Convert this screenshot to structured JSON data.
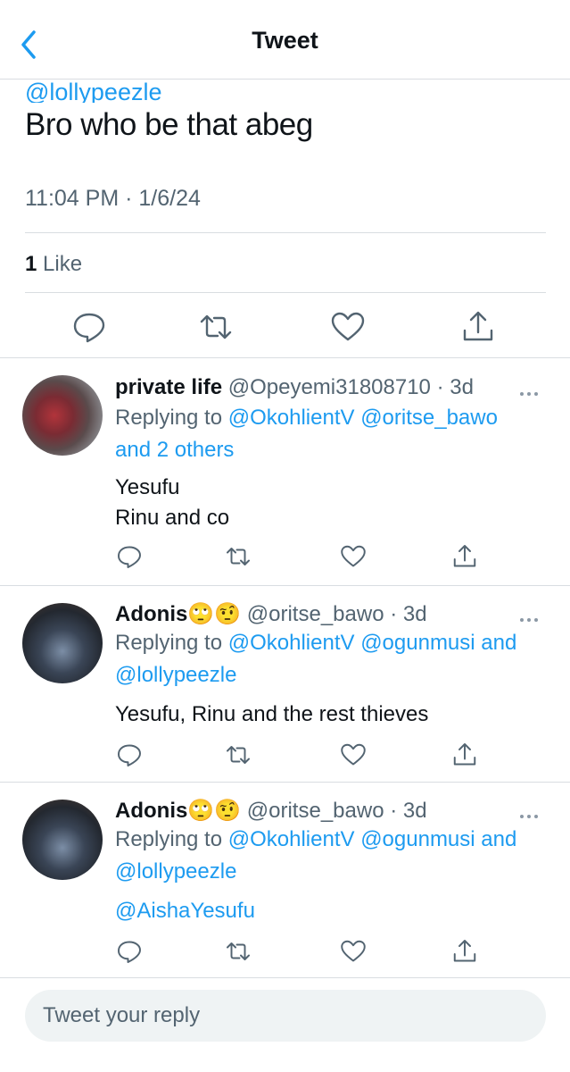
{
  "header": {
    "title": "Tweet",
    "back_icon": "chevron-left-icon"
  },
  "main_tweet": {
    "clipped_handle": "@lollypeezle",
    "text": "Bro who be that abeg",
    "timestamp": "11:04 PM · 1/6/24",
    "likes_count": "1",
    "likes_label": "Like"
  },
  "replies": [
    {
      "name": "private life",
      "name_emojis": "",
      "handle": "@Opeyemi31808710",
      "time": "· 3d",
      "replying_prefix": "Replying to",
      "replying_links": [
        "@OkohlientV",
        "@oritse_bawo"
      ],
      "replying_and": "and 2 others",
      "body_lines": [
        "Yesufu",
        "Rinu and co"
      ]
    },
    {
      "name": "Adonis",
      "name_emojis": "🙄🤨",
      "handle": "@oritse_bawo",
      "time": "· 3d",
      "replying_prefix": "Replying to",
      "replying_links": [
        "@OkohlientV",
        "@ogunmusi",
        "@lollypeezle"
      ],
      "replying_and": "and",
      "body_lines": [
        "Yesufu, Rinu and the rest thieves"
      ]
    },
    {
      "name": "Adonis",
      "name_emojis": "🙄🤨",
      "handle": "@oritse_bawo",
      "time": "· 3d",
      "replying_prefix": "Replying to",
      "replying_links": [
        "@OkohlientV",
        "@ogunmusi",
        "@lollypeezle"
      ],
      "replying_and": "and",
      "body_lines": [
        "@AishaYesufu"
      ]
    }
  ],
  "composer": {
    "placeholder": "Tweet your reply"
  },
  "colors": {
    "link": "#1d9bf0",
    "muted": "#536471",
    "divider": "#d9dde1"
  }
}
